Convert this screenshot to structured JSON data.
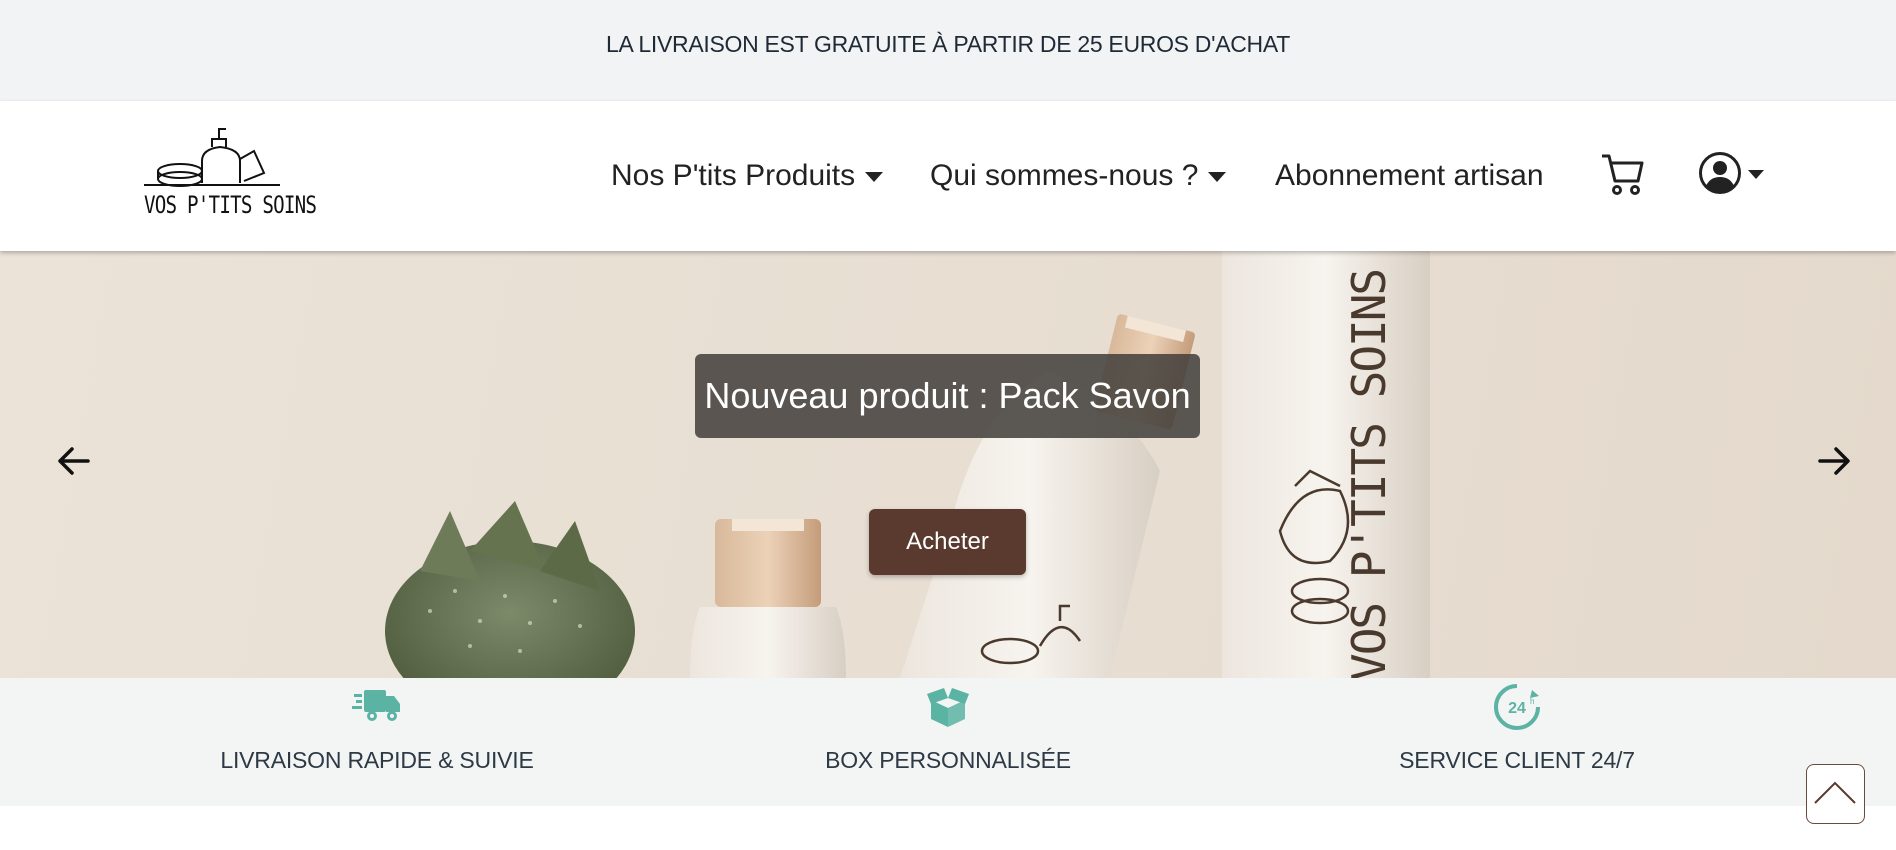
{
  "promo": {
    "text": "LA LIVRAISON EST GRATUITE À PARTIR DE 25 EUROS D'ACHAT"
  },
  "header": {
    "logo_text": "VOS P'TITS SOINS",
    "nav": [
      {
        "label": "Nos P'tits Produits",
        "has_dropdown": true
      },
      {
        "label": "Qui sommes-nous ?",
        "has_dropdown": true
      },
      {
        "label": "Abonnement artisan",
        "has_dropdown": false
      }
    ],
    "icons": [
      "cart-icon",
      "user-circle-icon"
    ]
  },
  "hero": {
    "title": "Nouveau produit : Pack Savon",
    "button_label": "Acheter",
    "bottle_brand": "VOS P'TITS SOINS"
  },
  "features": [
    {
      "label": "LIVRAISON RAPIDE & SUIVIE",
      "icon": "delivery-truck-icon"
    },
    {
      "label": "BOX PERSONNALISÉE",
      "icon": "box-icon"
    },
    {
      "label": "SERVICE CLIENT 24/7",
      "icon": "clock-24h-icon"
    }
  ],
  "colors": {
    "accent_teal": "#5bb3a3",
    "button_brown": "#5a3a2e",
    "promo_bg": "#f2f3f5",
    "features_bg": "#f3f4f4"
  }
}
